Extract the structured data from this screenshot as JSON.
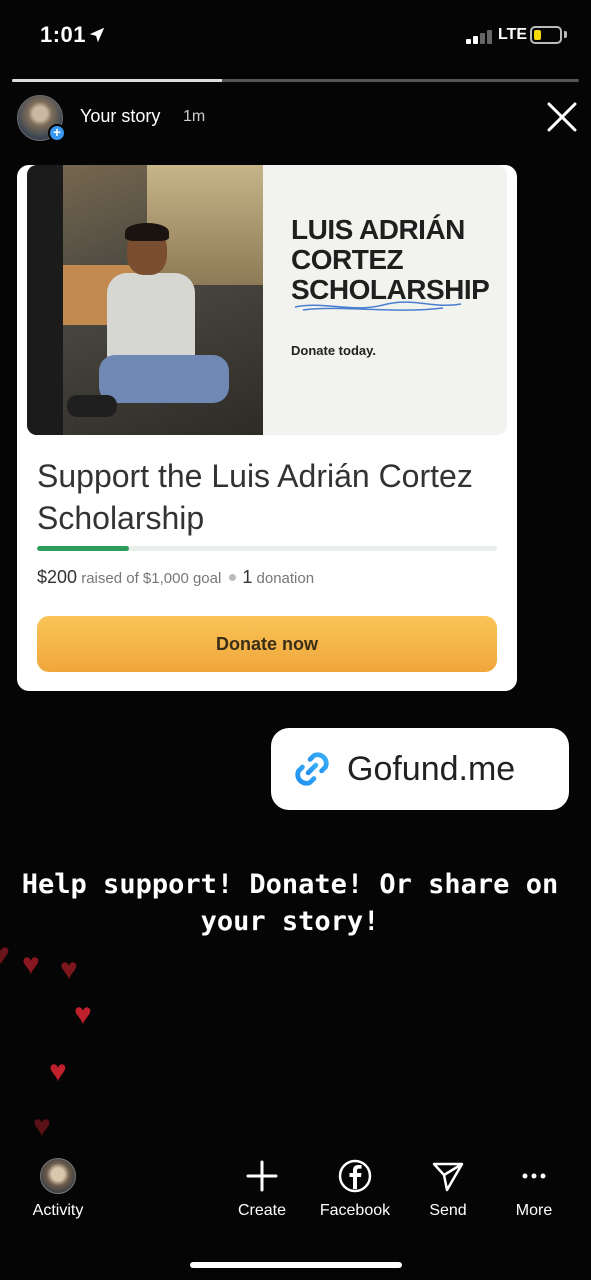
{
  "status_bar": {
    "time": "1:01",
    "network": "LTE",
    "battery_level": 0.3
  },
  "story_progress": 0.37,
  "header": {
    "title": "Your story",
    "time": "1m"
  },
  "card": {
    "image_title": "LUIS ADRIÁN CORTEZ SCHOLARSHIP",
    "image_subtitle": "Donate today.",
    "title": "Support the Luis Adrián Cortez Scholarship",
    "raised_amount": "$200",
    "raised_text": "raised of $1,000 goal",
    "donation_count": "1",
    "donation_text": "donation",
    "goal_progress": 0.2,
    "donate_label": "Donate now"
  },
  "link_sticker": {
    "label": "Gofund.me"
  },
  "caption": "Help support! Donate! Or share on your story!",
  "bottom_nav": {
    "activity": "Activity",
    "create": "Create",
    "facebook": "Facebook",
    "send": "Send",
    "more": "More"
  },
  "colors": {
    "accent_blue": "#3897f0",
    "progress_green": "#2d9d5c",
    "donate_orange": "#f0a63b",
    "heart_red": "#c0202c"
  },
  "icons": [
    "location-arrow-icon",
    "signal-icon",
    "battery-icon",
    "close-icon",
    "link-icon",
    "plus-icon",
    "facebook-icon",
    "send-icon",
    "more-icon",
    "heart-icon"
  ]
}
